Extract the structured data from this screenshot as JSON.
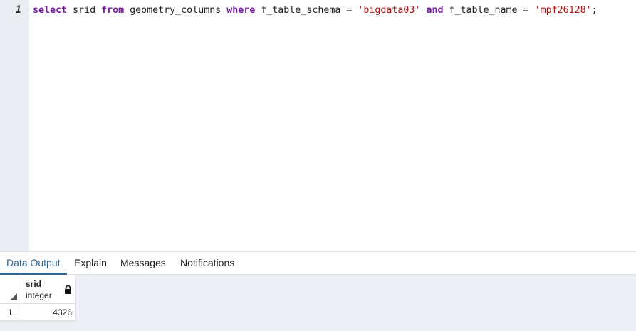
{
  "editor": {
    "line_number": "1",
    "tokens": [
      {
        "text": "select",
        "kind": "kw"
      },
      {
        "text": " srid ",
        "kind": "plain"
      },
      {
        "text": "from",
        "kind": "kw"
      },
      {
        "text": " geometry_columns ",
        "kind": "plain"
      },
      {
        "text": "where",
        "kind": "kw"
      },
      {
        "text": " f_table_schema = ",
        "kind": "plain"
      },
      {
        "text": "'bigdata03'",
        "kind": "str"
      },
      {
        "text": " ",
        "kind": "plain"
      },
      {
        "text": "and",
        "kind": "kw"
      },
      {
        "text": " f_table_name = ",
        "kind": "plain"
      },
      {
        "text": "'mpf26128'",
        "kind": "str"
      },
      {
        "text": ";",
        "kind": "plain"
      }
    ]
  },
  "tabs": {
    "data_output": "Data Output",
    "explain": "Explain",
    "messages": "Messages",
    "notifications": "Notifications"
  },
  "results": {
    "columns": [
      {
        "name": "srid",
        "type": "integer"
      }
    ],
    "rows": [
      {
        "row_number": "1",
        "values": [
          "4326"
        ]
      }
    ]
  },
  "colors": {
    "keyword": "#7b1fa2",
    "string": "#a31515",
    "active_tab": "#326690"
  },
  "icons": {
    "column_lock": "lock-icon",
    "select_all": "corner-triangle-icon"
  }
}
